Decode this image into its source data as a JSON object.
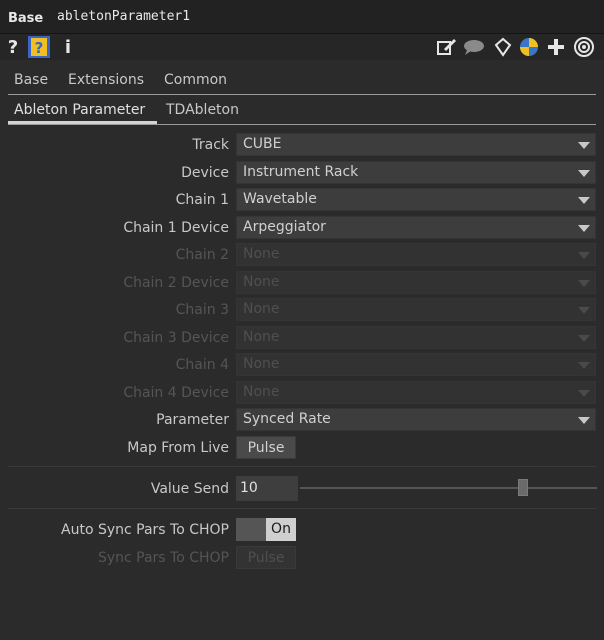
{
  "titlebar": {
    "op_type": "Base",
    "op_name": "abletonParameter1"
  },
  "iconbar": {
    "help_q": "?",
    "info": "i"
  },
  "page_tabs": [
    "Base",
    "Extensions",
    "Common"
  ],
  "custom_tabs": [
    "Ableton Parameter",
    "TDAbleton"
  ],
  "params": [
    {
      "label": "Track",
      "value": "CUBE",
      "enabled": true
    },
    {
      "label": "Device",
      "value": "Instrument Rack",
      "enabled": true
    },
    {
      "label": "Chain 1",
      "value": "Wavetable",
      "enabled": true
    },
    {
      "label": "Chain 1 Device",
      "value": "Arpeggiator",
      "enabled": true
    },
    {
      "label": "Chain 2",
      "value": "None",
      "enabled": false
    },
    {
      "label": "Chain 2 Device",
      "value": "None",
      "enabled": false
    },
    {
      "label": "Chain 3",
      "value": "None",
      "enabled": false
    },
    {
      "label": "Chain 3 Device",
      "value": "None",
      "enabled": false
    },
    {
      "label": "Chain 4",
      "value": "None",
      "enabled": false
    },
    {
      "label": "Chain 4 Device",
      "value": "None",
      "enabled": false
    },
    {
      "label": "Parameter",
      "value": "Synced Rate",
      "enabled": true
    }
  ],
  "map_from_live": {
    "label": "Map From Live",
    "button": "Pulse"
  },
  "value_send": {
    "label": "Value Send",
    "value": "10",
    "slider_fraction": 0.75
  },
  "auto_sync": {
    "label": "Auto Sync Pars To CHOP",
    "state": "On"
  },
  "sync_pars": {
    "label": "Sync Pars To CHOP",
    "button": "Pulse"
  },
  "colors": {
    "background": "#2b2b2b",
    "help_icon_bg": "#f0c020"
  }
}
